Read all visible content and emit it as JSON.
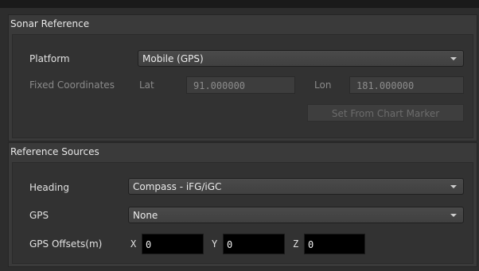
{
  "sonar_reference": {
    "title": "Sonar Reference",
    "platform_label": "Platform",
    "platform_value": "Mobile (GPS)",
    "fixed_coordinates_label": "Fixed Coordinates",
    "lat_label": "Lat",
    "lat_value": "91.000000",
    "lon_label": "Lon",
    "lon_value": "181.000000",
    "set_from_chart_marker_label": "Set From Chart Marker"
  },
  "reference_sources": {
    "title": "Reference Sources",
    "heading_label": "Heading",
    "heading_value": "Compass - iFG/iGC",
    "gps_label": "GPS",
    "gps_value": "None",
    "gps_offsets_label": "GPS Offsets(m)",
    "x_label": "X",
    "x_value": "0",
    "y_label": "Y",
    "y_value": "0",
    "z_label": "Z",
    "z_value": "0"
  },
  "colors": {
    "background": "#2d2d2d",
    "panel": "#3a3a3a",
    "inner_panel": "#323232",
    "disabled_text": "#8a8a8a"
  }
}
